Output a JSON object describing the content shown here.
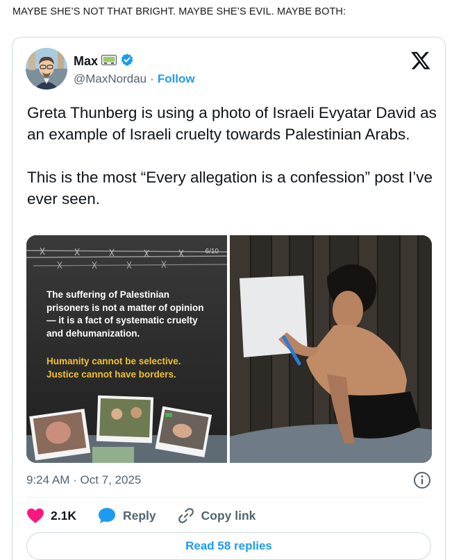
{
  "caption": "MAYBE SHE’S NOT THAT BRIGHT. MAYBE SHE’S EVIL. MAYBE BOTH:",
  "tweet": {
    "author_name": "Max",
    "handle": "@MaxNordau",
    "separator": "·",
    "follow_label": "Follow",
    "text": "Greta Thunberg is using a photo of Israeli Evyatar David as an example of Israeli cruelty towards Palestinian Arabs.\n\nThis is the most “Every allegation is a confession” post I’ve ever seen.",
    "timestamp": "9:24 AM · Oct 7, 2025",
    "media": {
      "left_image": {
        "page_indicator": "6/10",
        "text_white": "The suffering of Palestinian prisoners is not a matter of opinion — it is a fact of systematic cruelty and dehumanization.",
        "text_yellow": "Humanity cannot be selective.\nJustice cannot have borders."
      }
    },
    "actions": {
      "likes": "2.1K",
      "reply": "Reply",
      "copy_link": "Copy link"
    },
    "read_replies": "Read 58 replies"
  },
  "colors": {
    "link_blue": "#1d9bf0",
    "heart_red": "#f91880",
    "text_secondary": "#536471",
    "slide_yellow": "#f2c12e"
  },
  "icons": [
    "x-logo-icon",
    "verified-badge-icon",
    "name-emoji-icon",
    "info-icon",
    "heart-icon",
    "reply-bubble-icon",
    "link-icon"
  ]
}
